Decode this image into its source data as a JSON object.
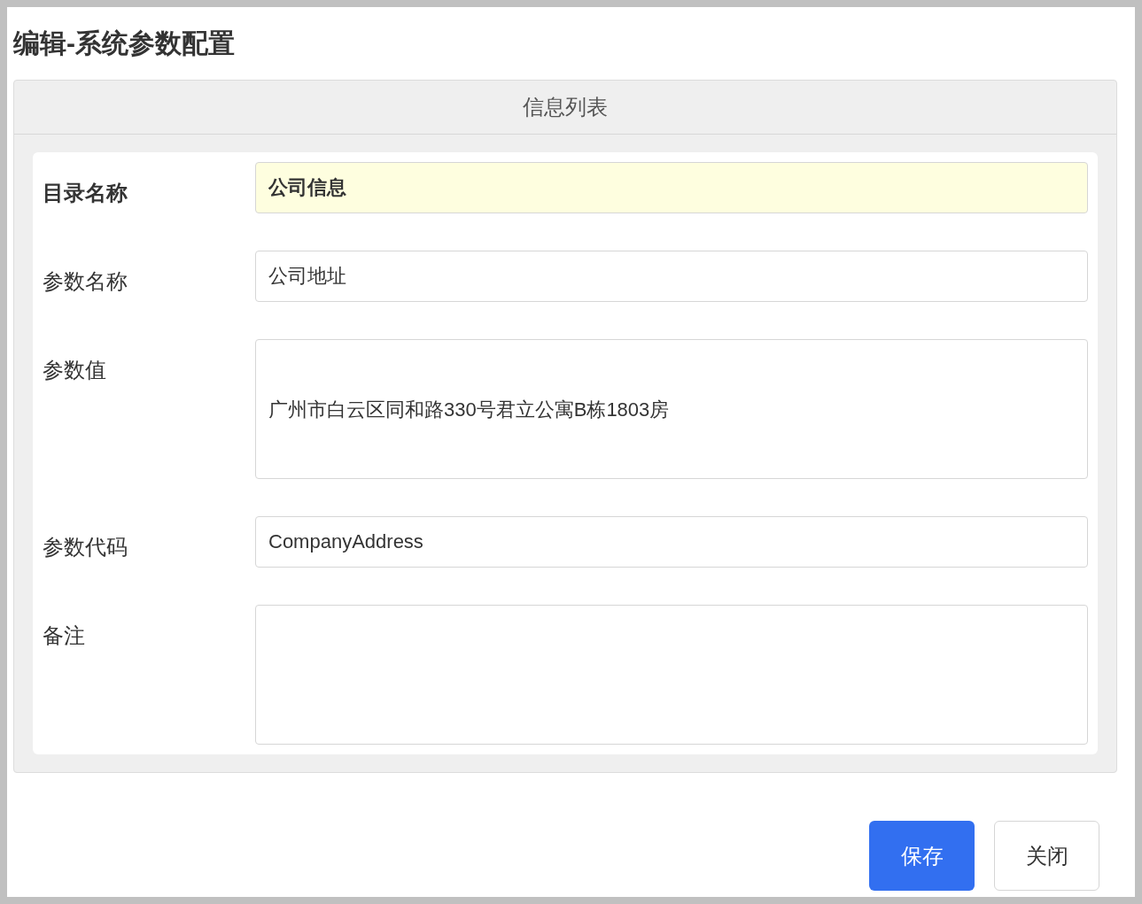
{
  "title": "编辑-系统参数配置",
  "panel": {
    "header": "信息列表",
    "fields": [
      {
        "label": "目录名称",
        "kind": "input",
        "value": "公司信息",
        "focused": true
      },
      {
        "label": "参数名称",
        "kind": "input",
        "value": "公司地址",
        "focused": false
      },
      {
        "label": "参数值",
        "kind": "textarea",
        "value": "广州市白云区同和路330号君立公寓B栋1803房",
        "focused": false
      },
      {
        "label": "参数代码",
        "kind": "input",
        "value": "CompanyAddress",
        "focused": false
      },
      {
        "label": "备注",
        "kind": "textarea",
        "focused": false
      }
    ]
  },
  "buttons": [
    {
      "label": "保存",
      "kind": "primary"
    },
    {
      "label": "关闭",
      "kind": "default"
    }
  ]
}
